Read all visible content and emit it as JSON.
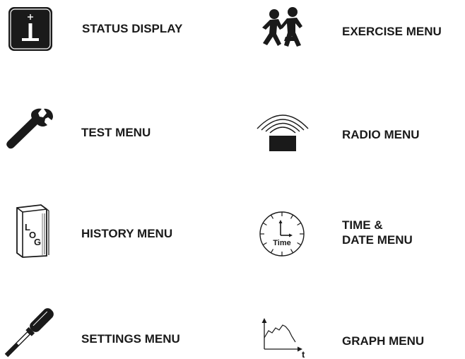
{
  "menu": {
    "items": [
      {
        "id": "status",
        "label": "STATUS DISPLAY",
        "icon": "info-icon"
      },
      {
        "id": "exercise",
        "label": "EXERCISE MENU",
        "icon": "running-children-icon"
      },
      {
        "id": "test",
        "label": "TEST MENU",
        "icon": "wrench-icon"
      },
      {
        "id": "radio",
        "label": "RADIO MENU",
        "icon": "radio-signal-icon"
      },
      {
        "id": "history",
        "label": "HISTORY MENU",
        "icon": "log-book-icon"
      },
      {
        "id": "time",
        "label_line1": "TIME &",
        "label_line2": "DATE MENU",
        "icon": "clock-icon",
        "icon_text": "Time"
      },
      {
        "id": "settings",
        "label": "SETTINGS MENU",
        "icon": "screwdriver-icon"
      },
      {
        "id": "graph",
        "label": "GRAPH MENU",
        "icon": "graph-icon",
        "icon_axis_label": "t"
      }
    ]
  },
  "log_icon_letters": [
    "L",
    "O",
    "G"
  ],
  "colors": {
    "text": "#1a1a1a",
    "icon": "#1a1a1a",
    "background": "#ffffff"
  }
}
